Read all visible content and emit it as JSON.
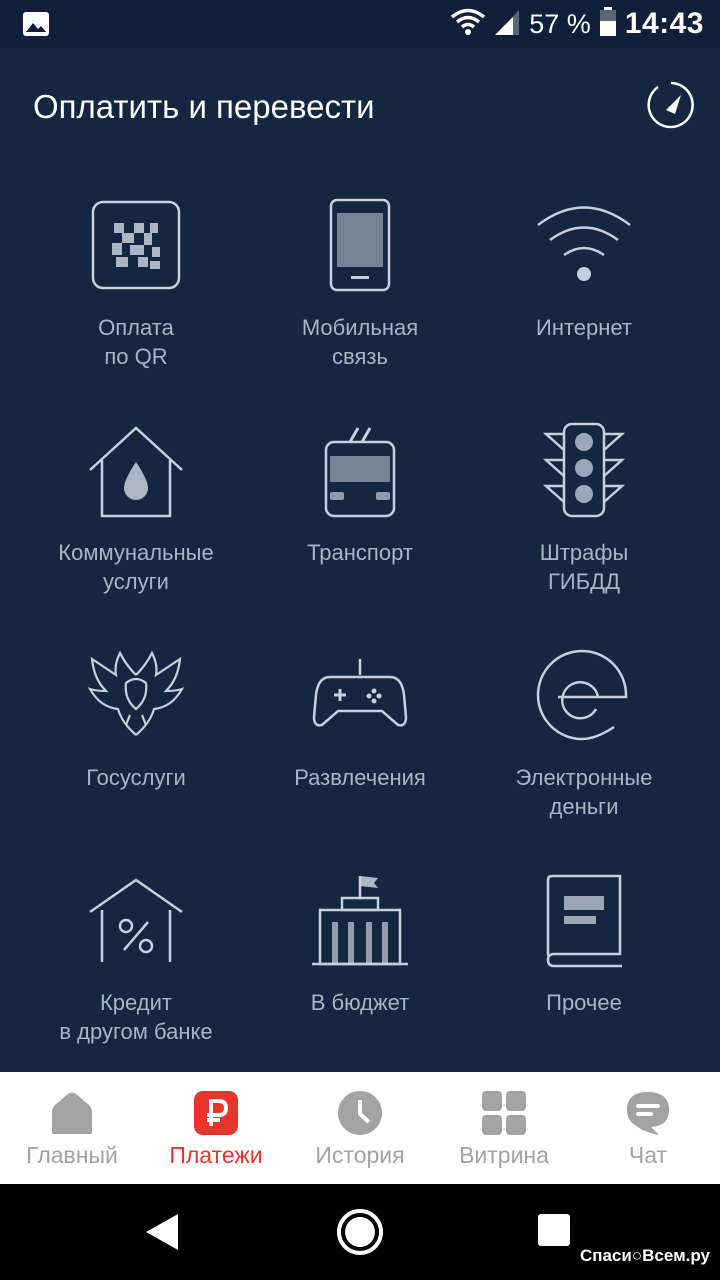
{
  "status_bar": {
    "battery_percent": "57 %",
    "time": "14:43"
  },
  "header": {
    "title": "Оплатить и перевести"
  },
  "tiles": [
    {
      "label": "Оплата\nпо QR",
      "icon": "qr-code-icon"
    },
    {
      "label": "Мобильная\nсвязь",
      "icon": "mobile-phone-icon"
    },
    {
      "label": "Интернет",
      "icon": "wifi-icon"
    },
    {
      "label": "Коммунальные\nуслуги",
      "icon": "house-drop-icon"
    },
    {
      "label": "Транспорт",
      "icon": "trolleybus-icon"
    },
    {
      "label": "Штрафы\nГИБДД",
      "icon": "traffic-light-icon"
    },
    {
      "label": "Госуслуги",
      "icon": "double-eagle-icon"
    },
    {
      "label": "Развлечения",
      "icon": "gamepad-icon"
    },
    {
      "label": "Электронные\nденьги",
      "icon": "e-money-icon"
    },
    {
      "label": "Кредит\nв другом банке",
      "icon": "credit-percent-icon"
    },
    {
      "label": "В бюджет",
      "icon": "government-building-icon"
    },
    {
      "label": "Прочее",
      "icon": "book-icon"
    }
  ],
  "tabbar": {
    "items": [
      {
        "label": "Главный",
        "icon": "home-icon",
        "active": false
      },
      {
        "label": "Платежи",
        "icon": "ruble-icon",
        "active": true
      },
      {
        "label": "История",
        "icon": "clock-icon",
        "active": false
      },
      {
        "label": "Витрина",
        "icon": "grid-icon",
        "active": false
      },
      {
        "label": "Чат",
        "icon": "chat-icon",
        "active": false
      }
    ]
  },
  "watermark": "Спаси○Всем.ру",
  "colors": {
    "background": "#142640",
    "label": "#a9b4c4",
    "icon_stroke": "#c7d0dc",
    "accent": "#e8352c",
    "tab_inactive": "#a3a3a3"
  }
}
